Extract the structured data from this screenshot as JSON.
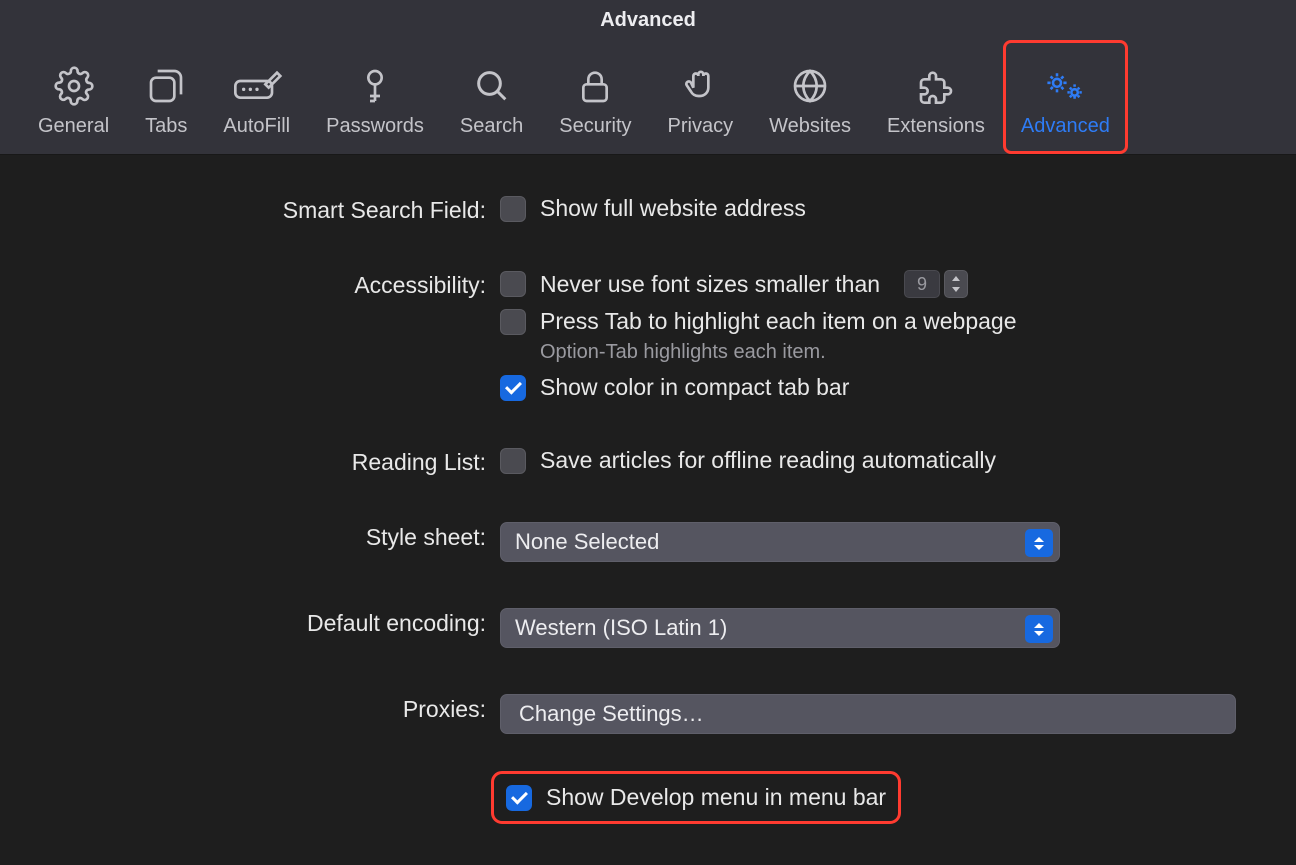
{
  "window": {
    "title": "Advanced"
  },
  "toolbar": {
    "items": [
      {
        "id": "general",
        "label": "General",
        "icon": "gear-icon"
      },
      {
        "id": "tabs",
        "label": "Tabs",
        "icon": "tabs-icon"
      },
      {
        "id": "autofill",
        "label": "AutoFill",
        "icon": "pencil-field-icon"
      },
      {
        "id": "passwords",
        "label": "Passwords",
        "icon": "key-icon"
      },
      {
        "id": "search",
        "label": "Search",
        "icon": "magnifying-glass-icon"
      },
      {
        "id": "security",
        "label": "Security",
        "icon": "lock-icon"
      },
      {
        "id": "privacy",
        "label": "Privacy",
        "icon": "hand-icon"
      },
      {
        "id": "websites",
        "label": "Websites",
        "icon": "globe-icon"
      },
      {
        "id": "extensions",
        "label": "Extensions",
        "icon": "puzzle-icon"
      },
      {
        "id": "advanced",
        "label": "Advanced",
        "icon": "double-gear-icon",
        "active": true
      }
    ]
  },
  "sections": {
    "smartSearch": {
      "label": "Smart Search Field:",
      "showFullAddress": {
        "checked": false,
        "label": "Show full website address"
      }
    },
    "accessibility": {
      "label": "Accessibility:",
      "minFont": {
        "checked": false,
        "label": "Never use font sizes smaller than",
        "value": "9"
      },
      "pressTab": {
        "checked": false,
        "label": "Press Tab to highlight each item on a webpage"
      },
      "hint": "Option-Tab highlights each item.",
      "compactColor": {
        "checked": true,
        "label": "Show color in compact tab bar"
      }
    },
    "readingList": {
      "label": "Reading List:",
      "saveOffline": {
        "checked": false,
        "label": "Save articles for offline reading automatically"
      }
    },
    "styleSheet": {
      "label": "Style sheet:",
      "value": "None Selected"
    },
    "encoding": {
      "label": "Default encoding:",
      "value": "Western (ISO Latin 1)"
    },
    "proxies": {
      "label": "Proxies:",
      "button": "Change Settings…"
    },
    "develop": {
      "checked": true,
      "label": "Show Develop menu in menu bar"
    }
  },
  "highlight_color": "#ff3b30",
  "accent_color": "#1769e0"
}
